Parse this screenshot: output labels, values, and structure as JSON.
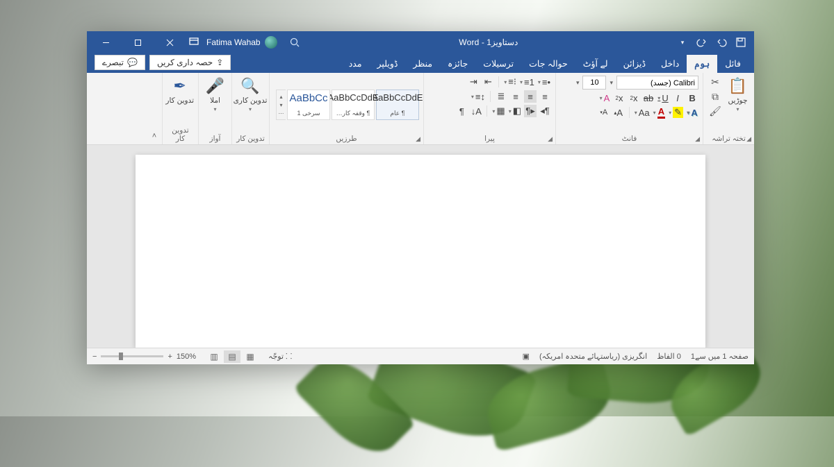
{
  "titlebar": {
    "app": "Word",
    "doc": "دستاویز1",
    "separator": " - ",
    "user": "Fatima Wahab",
    "qat_customize": "▾"
  },
  "tabs": {
    "items": [
      "فائل",
      "ہوم",
      "داخل",
      "ڈیزائن",
      "لے آؤٹ",
      "حوالہ جات",
      "ترسیلات",
      "جائزہ",
      "منظر",
      "ڈویلپر",
      "مدد"
    ],
    "active_index": 1,
    "share": "حصہ داری کریں",
    "comments": "تبصرے"
  },
  "ribbon": {
    "clipboard": {
      "label": "تختہ تراشہ",
      "paste": "چوڑیں"
    },
    "font": {
      "label": "فانٹ",
      "name": "Calibri (جسد)",
      "size": "10",
      "color_red": "#c00000",
      "highlight": "#fff200"
    },
    "paragraph": {
      "label": "پیرا"
    },
    "styles": {
      "label": "طرزیں",
      "cards": [
        {
          "preview": "AaBbCcDdE",
          "name": "¶ عام"
        },
        {
          "preview": "AaBbCcDdE",
          "name": "¶ وقفہ کار…"
        },
        {
          "preview": "AaBbCc",
          "name": "سرخی 1"
        }
      ]
    },
    "editing": {
      "label": "تدوین کار",
      "find": "تدوین کاری",
      "dictate": "املا",
      "editor": "تدوین کار"
    },
    "voice": {
      "label": "آواز"
    }
  },
  "status": {
    "page": "صفحہ 1 میں سے1",
    "words": "0 الفاظ",
    "language": "انگریزی (ریاستہائے متحدہ امریکہ)",
    "focus": "توجّہ",
    "zoom": "150%"
  }
}
